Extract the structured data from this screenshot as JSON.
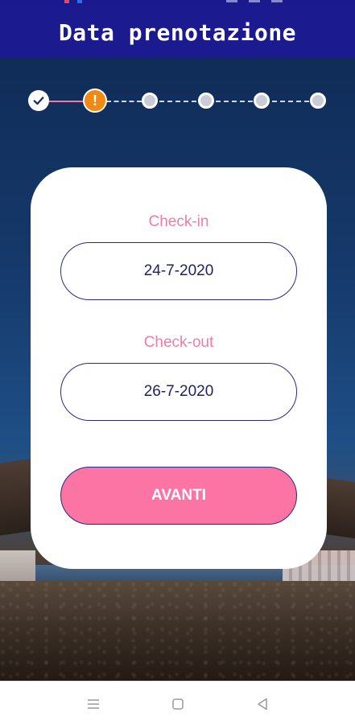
{
  "app": {
    "title": "Data prenotazione"
  },
  "stepper": {
    "steps": [
      {
        "state": "completed",
        "icon": "check-icon"
      },
      {
        "state": "current",
        "icon": "alert-icon",
        "glyph": "!"
      },
      {
        "state": "pending"
      },
      {
        "state": "pending"
      },
      {
        "state": "pending"
      },
      {
        "state": "pending"
      }
    ]
  },
  "form": {
    "checkin_label": "Check-in",
    "checkin_value": "24-7-2020",
    "checkout_label": "Check-out",
    "checkout_value": "26-7-2020",
    "next_label": "AVANTI"
  },
  "navbar": {
    "items": [
      {
        "icon": "menu-icon"
      },
      {
        "icon": "home-square-icon"
      },
      {
        "icon": "back-triangle-icon"
      }
    ]
  },
  "colors": {
    "appbar": "#1c1a8f",
    "accent_pink": "#fb74a4",
    "label_pink": "#ef7ca6",
    "border_navy": "#2a2a86",
    "current_step": "#f08a12"
  }
}
